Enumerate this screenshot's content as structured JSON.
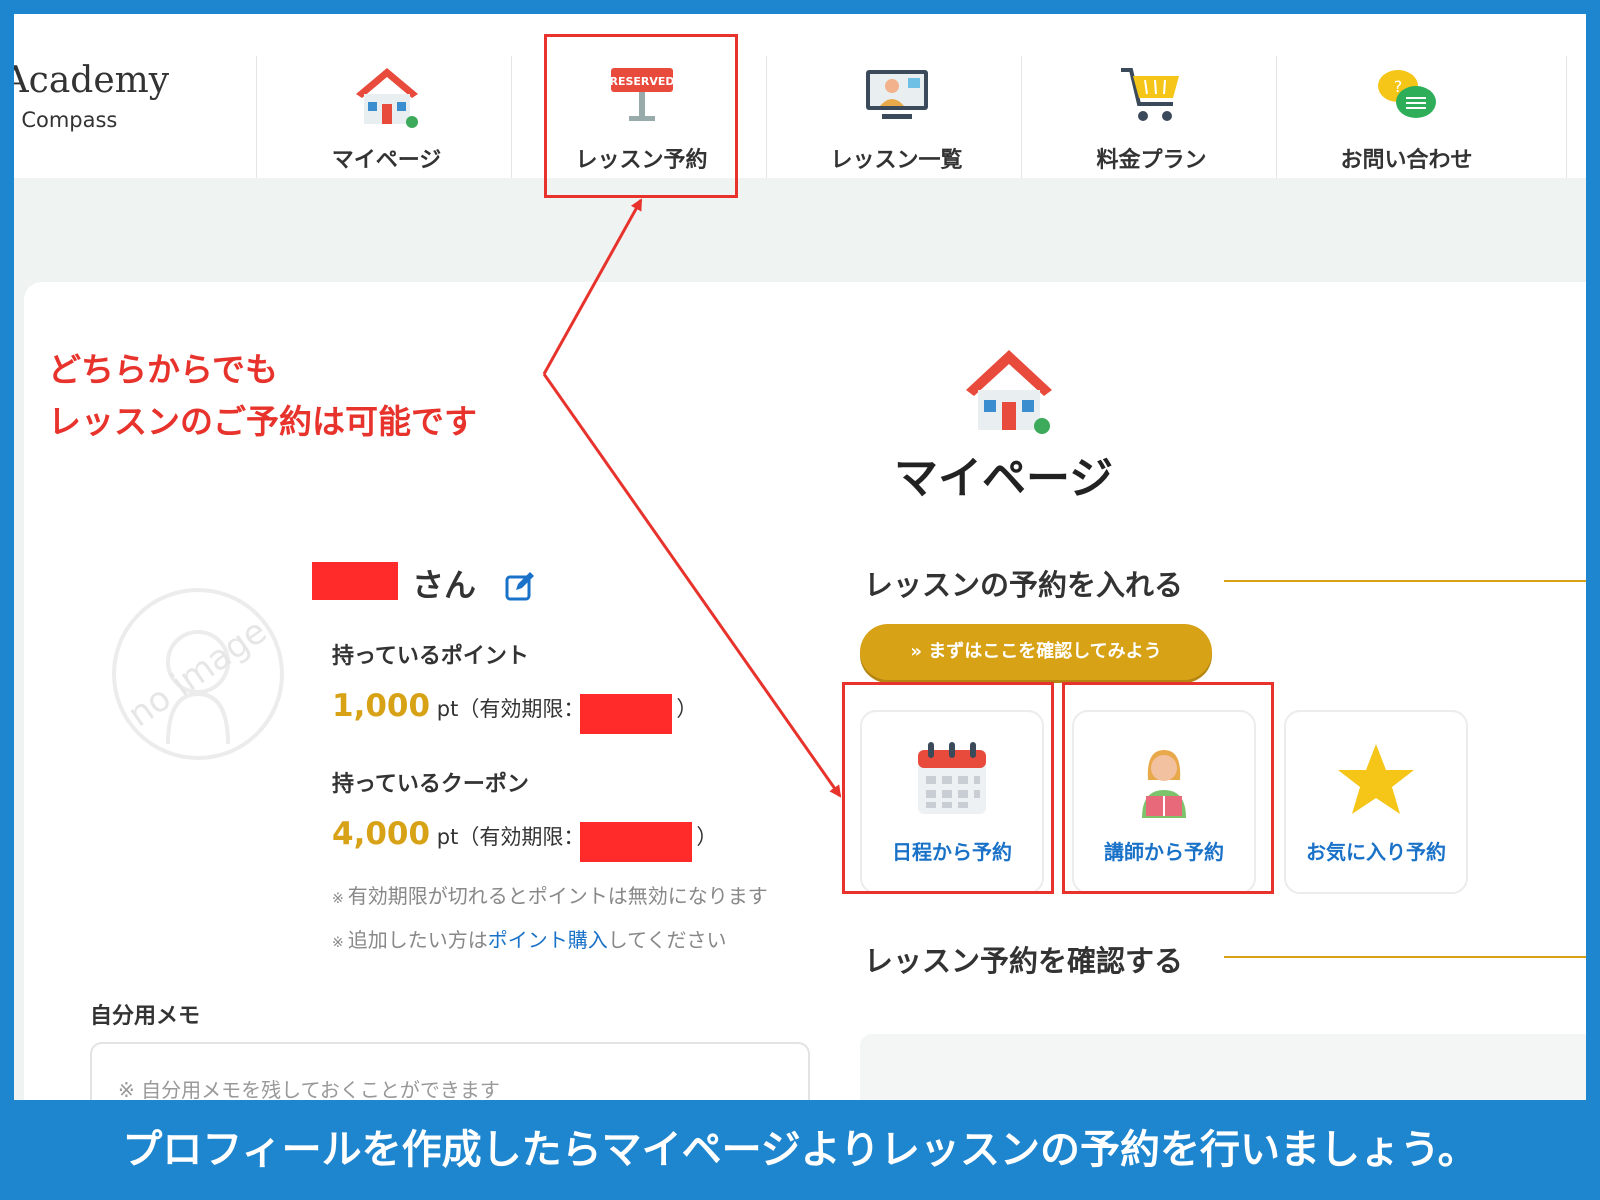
{
  "header": {
    "logo_line1": "r Academy",
    "logo_line2": "orld Compass",
    "nav": [
      {
        "label": "マイページ",
        "icon": "house-icon"
      },
      {
        "label": "レッスン予約",
        "icon": "reserved-sign-icon"
      },
      {
        "label": "レッスン一覧",
        "icon": "online-teacher-icon"
      },
      {
        "label": "料金プラン",
        "icon": "shopping-cart-icon"
      },
      {
        "label": "お問い合わせ",
        "icon": "speech-bubbles-icon"
      }
    ]
  },
  "annotation": {
    "line1": "どちらからでも",
    "line2": "レッスンのご予約は可能です",
    "color": "#e8332c"
  },
  "main": {
    "page_title": "マイページ",
    "profile": {
      "avatar_text": "no image",
      "name_suffix": "さん",
      "points_label": "持っているポイント",
      "points_value": "1,000",
      "coupon_label": "持っているクーポン",
      "coupon_value": "4,000",
      "unit": "pt",
      "expiry_prefix": "（有効期限：",
      "expiry_suffix": "）",
      "note1": "有効期限が切れるとポイントは無効になります",
      "note2_before": "追加したい方は",
      "note2_link": "ポイント購入",
      "note2_after": "してください",
      "note_mark": "※"
    },
    "memo": {
      "label": "自分用メモ",
      "placeholder": "※ 自分用メモを残しておくことができます"
    },
    "reserve_section": {
      "title": "レッスンの予約を入れる",
      "check_button": "» まずはここを確認してみよう",
      "cards": [
        {
          "label": "日程から予約",
          "icon": "calendar-icon"
        },
        {
          "label": "講師から予約",
          "icon": "teacher-icon"
        },
        {
          "label": "お気に入り予約",
          "icon": "star-icon"
        }
      ]
    },
    "confirm_section": {
      "title": "レッスン予約を確認する"
    }
  },
  "caption": "プロフィールを作成したらマイページよりレッスンの予約を行いましょう。",
  "colors": {
    "accent": "#d8a217",
    "link": "#1a72c8",
    "frame": "#1e85cf"
  }
}
